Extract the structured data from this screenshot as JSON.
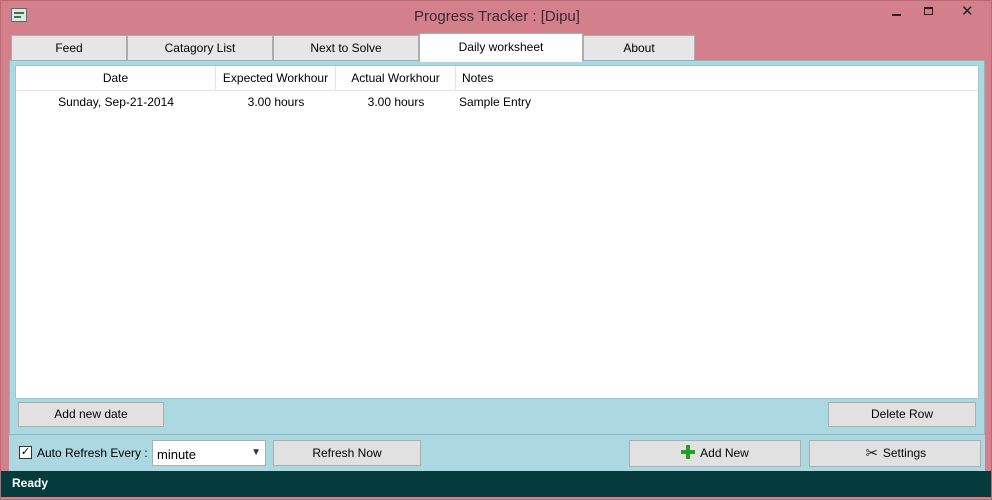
{
  "window": {
    "title": "Progress Tracker : [Dipu]",
    "close_glyph": "✕"
  },
  "tabs": [
    {
      "label": "Feed"
    },
    {
      "label": "Catagory List"
    },
    {
      "label": "Next to Solve"
    },
    {
      "label": "Daily worksheet",
      "active": true
    },
    {
      "label": "About"
    }
  ],
  "grid": {
    "columns": [
      "Date",
      "Expected Workhour",
      "Actual Workhour",
      "Notes"
    ],
    "rows": [
      [
        "Sunday, Sep-21-2014",
        "3.00 hours",
        "3.00 hours",
        "Sample Entry"
      ]
    ]
  },
  "panel_buttons": {
    "add_new_date": "Add new date",
    "delete_row": "Delete Row"
  },
  "toolbar": {
    "auto_refresh_label": "Auto Refresh Every :",
    "auto_refresh_checked": true,
    "checkmark": "✓",
    "refresh_interval": "minute",
    "dropdown_arrow": "▼",
    "refresh_now": "Refresh Now",
    "add_new": "Add New",
    "settings": "Settings",
    "settings_glyph": "✂"
  },
  "status": {
    "text": "Ready"
  },
  "colors": {
    "window_frame": "#d47f8c",
    "panel_bg": "#abd8e1",
    "status_bg": "#063b3d",
    "add_icon": "#21a021"
  }
}
